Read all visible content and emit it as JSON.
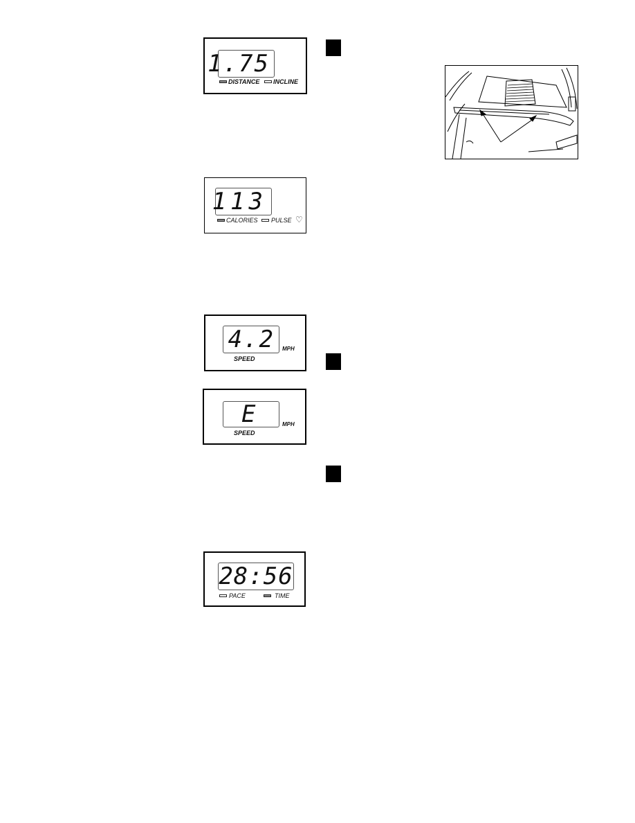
{
  "displays": [
    {
      "id": "distance",
      "value": "1.75",
      "indicators": [
        {
          "label": "DISTANCE",
          "state": "on"
        },
        {
          "label": "INCLINE",
          "state": "off"
        }
      ]
    },
    {
      "id": "calories",
      "value": "113",
      "indicators": [
        {
          "label": "CALORIES",
          "state": "on"
        },
        {
          "label": "PULSE",
          "state": "off"
        }
      ],
      "heart_icon": "heart-outline-icon"
    },
    {
      "id": "speed",
      "value": "4.2",
      "unit": "MPH",
      "caption": "SPEED"
    },
    {
      "id": "speed-error",
      "value": "E",
      "unit": "MPH",
      "caption": "SPEED"
    },
    {
      "id": "time",
      "value": "28:56",
      "indicators": [
        {
          "label": "PACE",
          "state": "off"
        },
        {
          "label": "TIME",
          "state": "on"
        }
      ]
    }
  ],
  "step_markers": [
    "step-1",
    "step-2",
    "step-3"
  ],
  "figure": {
    "description": "treadmill-handrail-sensors-illustration",
    "arrows": 2
  }
}
